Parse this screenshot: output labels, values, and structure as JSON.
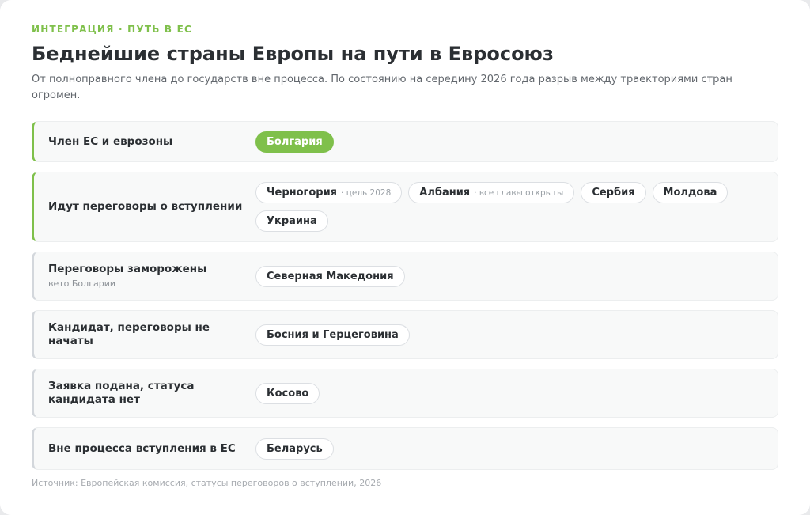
{
  "header": {
    "kicker": "ИНТЕГРАЦИЯ · ПУТЬ В ЕС",
    "title": "Беднейшие страны Европы на пути в Евросоюз",
    "subtitle": "От полноправного члена до государств вне процесса. По состоянию на середину 2026 года разрыв между траекториями стран огромен."
  },
  "colors": {
    "accent": "#7fc04b",
    "inactive_border": "#d3d7dc"
  },
  "stages": [
    {
      "title": "Член ЕС и еврозоны",
      "note": "",
      "countries": [
        {
          "name": "Болгария",
          "note": "",
          "filled": true
        }
      ]
    },
    {
      "title": "Идут переговоры о вступлении",
      "note": "",
      "countries": [
        {
          "name": "Черногория",
          "note": "· цель 2028"
        },
        {
          "name": "Албания",
          "note": "· все главы открыты"
        },
        {
          "name": "Сербия",
          "note": ""
        },
        {
          "name": "Молдова",
          "note": ""
        },
        {
          "name": "Украина",
          "note": ""
        }
      ]
    },
    {
      "title": "Переговоры заморожены",
      "note": "вето Болгарии",
      "countries": [
        {
          "name": "Северная Македония",
          "note": ""
        }
      ]
    },
    {
      "title": "Кандидат, переговоры не начаты",
      "note": "",
      "countries": [
        {
          "name": "Босния и Герцеговина",
          "note": ""
        }
      ]
    },
    {
      "title": "Заявка подана, статуса кандидата нет",
      "note": "",
      "countries": [
        {
          "name": "Косово",
          "note": ""
        }
      ]
    },
    {
      "title": "Вне процесса вступления в ЕС",
      "note": "",
      "countries": [
        {
          "name": "Беларусь",
          "note": ""
        }
      ]
    }
  ],
  "source": "Источник: Европейская комиссия, статусы переговоров о вступлении, 2026"
}
